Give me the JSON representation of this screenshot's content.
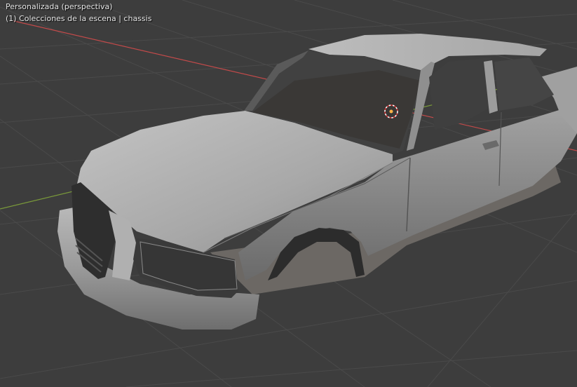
{
  "viewport": {
    "view_label": "Personalizada (perspectiva)",
    "collection_label": "(1) Colecciones de la escena | chassis",
    "background_color": "#3d3d3d",
    "grid_color": "#4a4a4a",
    "x_axis_color": "#c24a4a",
    "y_axis_color": "#7a9a3a",
    "origin_icon": "3d-cursor-icon",
    "object": "car-body-mesh"
  }
}
